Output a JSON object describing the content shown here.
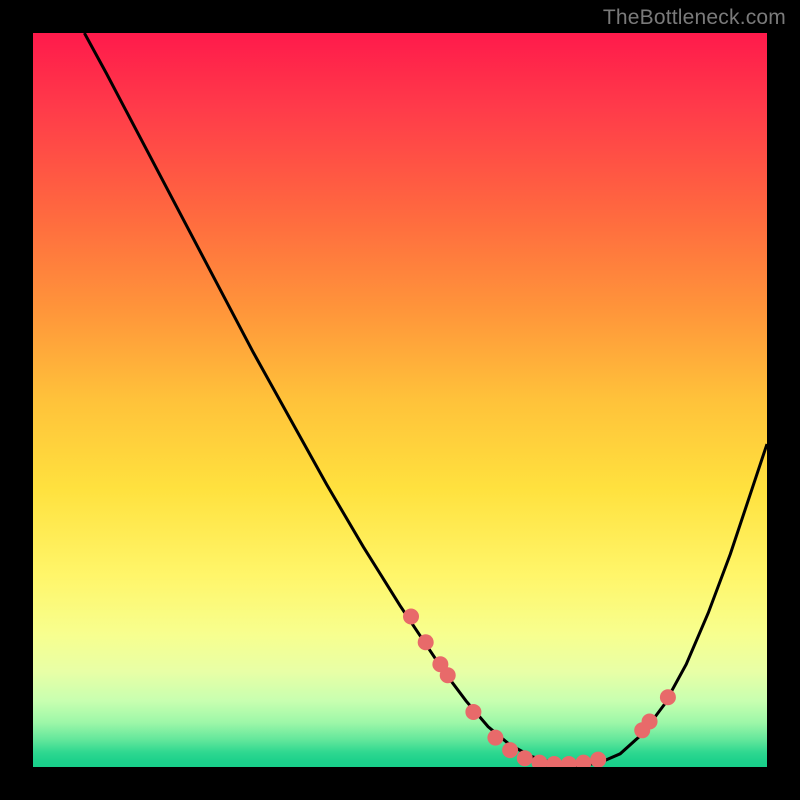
{
  "watermark": "TheBottleneck.com",
  "chart_data": {
    "type": "line",
    "title": "",
    "xlabel": "",
    "ylabel": "",
    "xlim": [
      0,
      100
    ],
    "ylim": [
      0,
      100
    ],
    "curve": {
      "name": "bottleneck-curve",
      "x": [
        7,
        10,
        15,
        20,
        25,
        30,
        35,
        40,
        45,
        50,
        53,
        56,
        59,
        62,
        65,
        68,
        71,
        74,
        77,
        80,
        83,
        86,
        89,
        92,
        95,
        98,
        100
      ],
      "y": [
        100,
        94.5,
        85,
        75.5,
        66,
        56.5,
        47.5,
        38.5,
        30,
        22,
        17.5,
        13,
        9,
        5.5,
        3,
        1.4,
        0.5,
        0.2,
        0.5,
        1.8,
        4.5,
        8.5,
        14,
        21,
        29,
        38,
        44
      ]
    },
    "markers": {
      "name": "highlight-dots",
      "color": "#e86a6a",
      "radius_px": 8,
      "x": [
        51.5,
        53.5,
        55.5,
        56.5,
        60,
        63,
        65,
        67,
        69,
        71,
        73,
        75,
        77,
        83,
        84,
        86.5
      ],
      "y": [
        20.5,
        17,
        14,
        12.5,
        7.5,
        4,
        2.3,
        1.2,
        0.6,
        0.4,
        0.4,
        0.6,
        1.0,
        5,
        6.2,
        9.5
      ]
    },
    "gradient_stops": [
      {
        "pct": 0,
        "hex": "#ff1a4b"
      },
      {
        "pct": 10,
        "hex": "#ff3a4a"
      },
      {
        "pct": 25,
        "hex": "#ff6a3f"
      },
      {
        "pct": 38,
        "hex": "#ff963a"
      },
      {
        "pct": 50,
        "hex": "#ffc23a"
      },
      {
        "pct": 62,
        "hex": "#ffe13e"
      },
      {
        "pct": 74,
        "hex": "#fff66a"
      },
      {
        "pct": 82,
        "hex": "#f7ff8f"
      },
      {
        "pct": 87,
        "hex": "#e8ffa6"
      },
      {
        "pct": 91,
        "hex": "#c8ffb0"
      },
      {
        "pct": 94,
        "hex": "#9cf7a8"
      },
      {
        "pct": 96.5,
        "hex": "#5de59a"
      },
      {
        "pct": 98,
        "hex": "#2fd890"
      },
      {
        "pct": 99,
        "hex": "#1fd28c"
      },
      {
        "pct": 100,
        "hex": "#18cf8a"
      }
    ]
  }
}
